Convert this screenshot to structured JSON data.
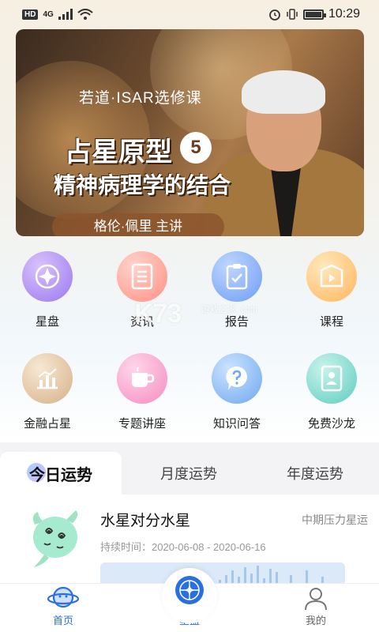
{
  "status_bar": {
    "network": "HD",
    "signal": "4G",
    "time": "10:29"
  },
  "banner": {
    "subtitle": "若道·ISAR选修课",
    "title_line1": "占星原型",
    "badge": "5",
    "title_line2": "精神病理学的结合",
    "lecturer": "格伦·佩里 主讲",
    "dot_count": 7,
    "active_dot": 1
  },
  "grid": [
    {
      "label": "星盘",
      "icon": "compass-star-icon",
      "color_from": "#c9a8f5",
      "color_to": "#9d7bf0"
    },
    {
      "label": "资讯",
      "icon": "document-list-icon",
      "color_from": "#ffc4b8",
      "color_to": "#ff8f84"
    },
    {
      "label": "报告",
      "icon": "clipboard-check-icon",
      "color_from": "#a9c9ff",
      "color_to": "#6e9cf5"
    },
    {
      "label": "课程",
      "icon": "play-video-icon",
      "color_from": "#ffe0a6",
      "color_to": "#ffb65c"
    },
    {
      "label": "金融占星",
      "icon": "bar-chart-icon",
      "color_from": "#f3dfc2",
      "color_to": "#d9b68e"
    },
    {
      "label": "专题讲座",
      "icon": "coffee-cup-icon",
      "color_from": "#ffc8e2",
      "color_to": "#f58cc0"
    },
    {
      "label": "知识问答",
      "icon": "question-bubble-icon",
      "color_from": "#b9d9ff",
      "color_to": "#6fa8ef"
    },
    {
      "label": "免费沙龙",
      "icon": "person-card-icon",
      "color_from": "#b3ece4",
      "color_to": "#5fcdbf"
    }
  ],
  "watermark": {
    "main": "K73",
    "small": "游戏之家 .com"
  },
  "tabs": [
    {
      "label": "今日运势",
      "active": true
    },
    {
      "label": "月度运势",
      "active": false
    },
    {
      "label": "年度运势",
      "active": false
    }
  ],
  "card": {
    "title": "水星对分水星",
    "tag": "中期压力星运",
    "duration_label": "持续时间：2020-06-08 - 2020-06-16"
  },
  "bottom_nav": [
    {
      "label": "首页",
      "icon": "planet-icon",
      "active": true
    },
    {
      "label": "星盘",
      "icon": "star-compass-icon",
      "active": true
    },
    {
      "label": "我的",
      "icon": "user-icon",
      "active": false
    }
  ],
  "colors": {
    "accent": "#2a6fe0",
    "inactive": "#666666"
  }
}
